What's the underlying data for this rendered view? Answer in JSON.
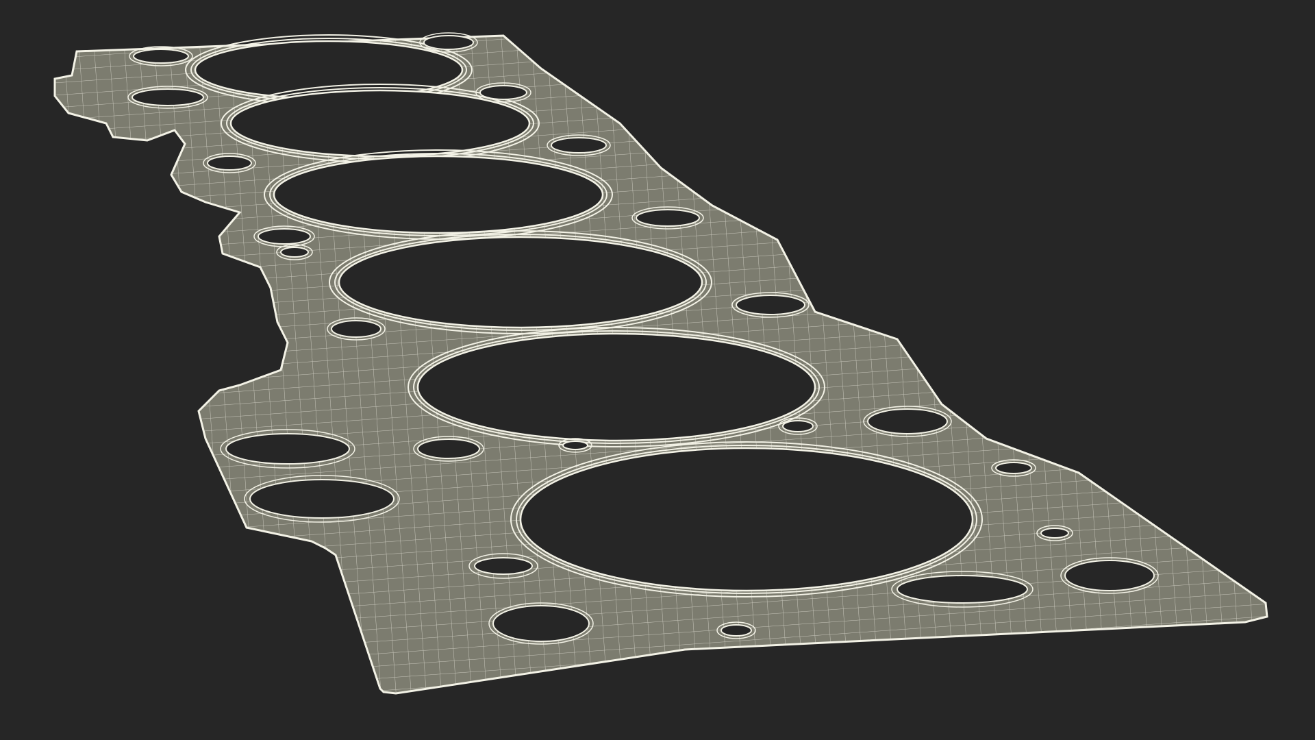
{
  "scene": {
    "subject": "head-gasket-wireframe",
    "render_style": "wireframe",
    "cylinder_bore_count": 6
  },
  "colors": {
    "background": "#262626",
    "gasket_fill": "#7c7c6f",
    "wire": "#f3f2e6",
    "hole": "#262626"
  }
}
